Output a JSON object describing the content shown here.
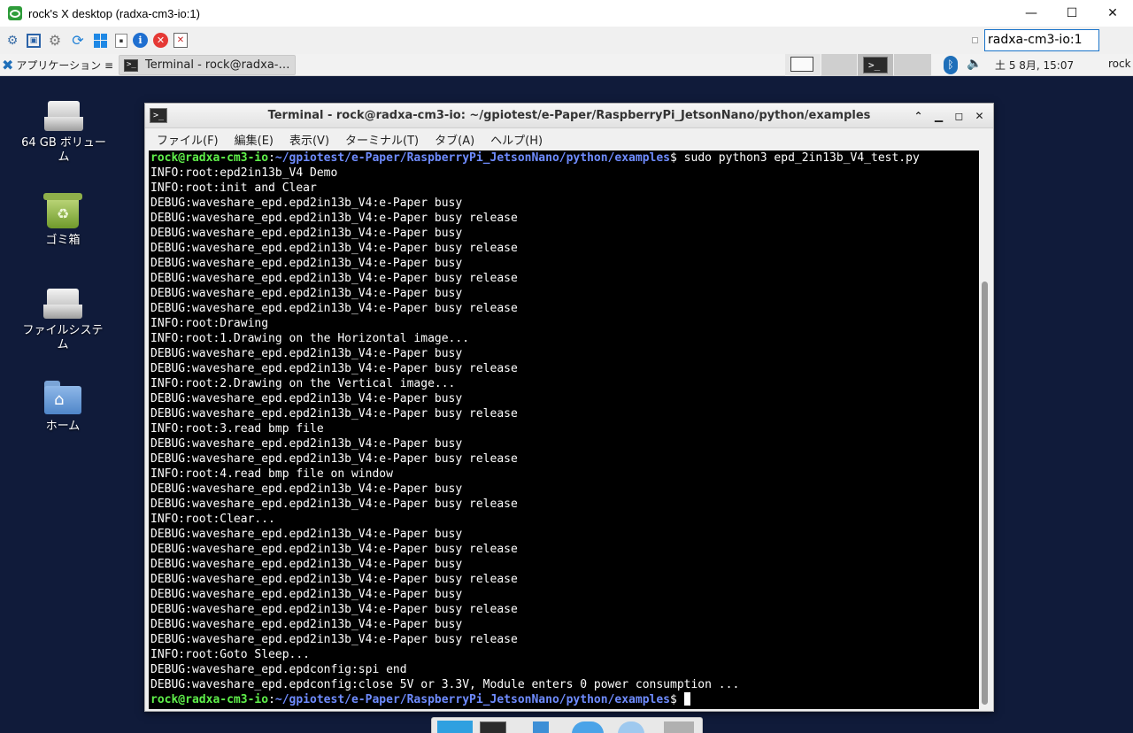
{
  "host_window": {
    "title": "rock's X desktop (radxa-cm3-io:1)",
    "controls": {
      "minimize": "—",
      "maximize": "☐",
      "close": "✕"
    }
  },
  "vnc_toolbar": {
    "tools": [
      "options-icon",
      "fullscreen-icon",
      "settings-icon",
      "refresh-icon",
      "windows-key-icon",
      "ctrl-alt-del-icon",
      "info-icon",
      "disconnect-icon",
      "file-transfer-icon"
    ],
    "server_field_value": "radxa-cm3-io:1"
  },
  "xfce_panel": {
    "apps_menu_label": "アプリケーション ≡",
    "taskbar_item": "Terminal - rock@radxa-…",
    "clock": "土  5  8月, 15:07",
    "user": "rock"
  },
  "desktop": {
    "icons": [
      {
        "label": "64 GB ボリューム"
      },
      {
        "label": "ゴミ箱"
      },
      {
        "label": "ファイルシステム"
      },
      {
        "label": "ホーム"
      }
    ]
  },
  "terminal": {
    "title": "Terminal - rock@radxa-cm3-io: ~/gpiotest/e-Paper/RaspberryPi_JetsonNano/python/examples",
    "menus": [
      "ファイル(F)",
      "編集(E)",
      "表示(V)",
      "ターミナル(T)",
      "タブ(A)",
      "ヘルプ(H)"
    ],
    "prompt_user": "rock@radxa-cm3-io",
    "prompt_colon": ":",
    "prompt_path": "~/gpiotest/e-Paper/RaspberryPi_JetsonNano/python/examples",
    "prompt_symbol": "$",
    "command": " sudo python3 epd_2in13b_V4_test.py",
    "output_lines": [
      "INFO:root:epd2in13b_V4 Demo",
      "INFO:root:init and Clear",
      "DEBUG:waveshare_epd.epd2in13b_V4:e-Paper busy",
      "DEBUG:waveshare_epd.epd2in13b_V4:e-Paper busy release",
      "DEBUG:waveshare_epd.epd2in13b_V4:e-Paper busy",
      "DEBUG:waveshare_epd.epd2in13b_V4:e-Paper busy release",
      "DEBUG:waveshare_epd.epd2in13b_V4:e-Paper busy",
      "DEBUG:waveshare_epd.epd2in13b_V4:e-Paper busy release",
      "DEBUG:waveshare_epd.epd2in13b_V4:e-Paper busy",
      "DEBUG:waveshare_epd.epd2in13b_V4:e-Paper busy release",
      "INFO:root:Drawing",
      "INFO:root:1.Drawing on the Horizontal image...",
      "DEBUG:waveshare_epd.epd2in13b_V4:e-Paper busy",
      "DEBUG:waveshare_epd.epd2in13b_V4:e-Paper busy release",
      "INFO:root:2.Drawing on the Vertical image...",
      "DEBUG:waveshare_epd.epd2in13b_V4:e-Paper busy",
      "DEBUG:waveshare_epd.epd2in13b_V4:e-Paper busy release",
      "INFO:root:3.read bmp file",
      "DEBUG:waveshare_epd.epd2in13b_V4:e-Paper busy",
      "DEBUG:waveshare_epd.epd2in13b_V4:e-Paper busy release",
      "INFO:root:4.read bmp file on window",
      "DEBUG:waveshare_epd.epd2in13b_V4:e-Paper busy",
      "DEBUG:waveshare_epd.epd2in13b_V4:e-Paper busy release",
      "INFO:root:Clear...",
      "DEBUG:waveshare_epd.epd2in13b_V4:e-Paper busy",
      "DEBUG:waveshare_epd.epd2in13b_V4:e-Paper busy release",
      "DEBUG:waveshare_epd.epd2in13b_V4:e-Paper busy",
      "DEBUG:waveshare_epd.epd2in13b_V4:e-Paper busy release",
      "DEBUG:waveshare_epd.epd2in13b_V4:e-Paper busy",
      "DEBUG:waveshare_epd.epd2in13b_V4:e-Paper busy release",
      "DEBUG:waveshare_epd.epd2in13b_V4:e-Paper busy",
      "DEBUG:waveshare_epd.epd2in13b_V4:e-Paper busy release",
      "INFO:root:Goto Sleep...",
      "DEBUG:waveshare_epd.epdconfig:spi end",
      "DEBUG:waveshare_epd.epdconfig:close 5V or 3.3V, Module enters 0 power consumption ..."
    ],
    "colors": {
      "user": "#5ff04a",
      "path": "#6f8cff",
      "text": "#ffffff",
      "background": "#000000"
    }
  },
  "colors": {
    "desktop_background": "#101b3a",
    "accent": "#1f6fb9"
  }
}
